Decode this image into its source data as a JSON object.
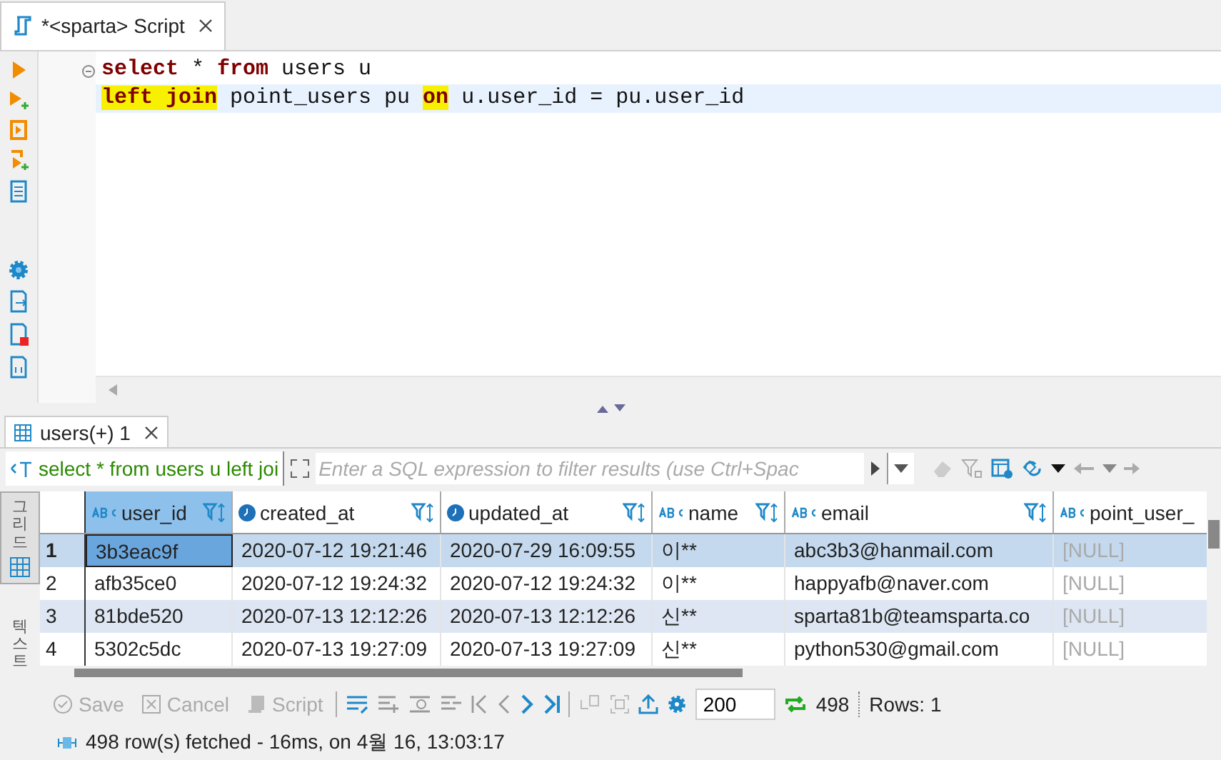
{
  "editor_tab": {
    "title": "*<sparta> Script"
  },
  "code_lines": [
    {
      "current": false,
      "tokens": [
        {
          "text": "select",
          "kind": "keyword",
          "highlighted": false
        },
        {
          "text": " * ",
          "kind": "plain",
          "highlighted": false
        },
        {
          "text": "from",
          "kind": "keyword",
          "highlighted": false
        },
        {
          "text": " users u",
          "kind": "plain",
          "highlighted": false
        }
      ]
    },
    {
      "current": true,
      "tokens": [
        {
          "text": "left join",
          "kind": "keyword",
          "highlighted": true
        },
        {
          "text": " point_users pu ",
          "kind": "plain",
          "highlighted": false
        },
        {
          "text": "on",
          "kind": "keyword",
          "highlighted": true
        },
        {
          "text": " u.user_id = pu.user_id",
          "kind": "plain",
          "highlighted": false
        }
      ]
    }
  ],
  "results_tab": {
    "title": "users(+) 1"
  },
  "filter": {
    "query": "select * from users u left joi",
    "placeholder": "Enter a SQL expression to filter results (use Ctrl+Spac"
  },
  "side_tabs": [
    {
      "label": "그리드",
      "selected": true
    },
    {
      "label": "텍스트",
      "selected": false
    }
  ],
  "columns": [
    {
      "name": "user_id",
      "kind": "text",
      "selected": true
    },
    {
      "name": "created_at",
      "kind": "datetime",
      "selected": false
    },
    {
      "name": "updated_at",
      "kind": "datetime",
      "selected": false
    },
    {
      "name": "name",
      "kind": "text",
      "selected": false
    },
    {
      "name": "email",
      "kind": "text",
      "selected": false
    },
    {
      "name": "point_user_",
      "kind": "text",
      "selected": false
    }
  ],
  "rows": [
    {
      "number": "1",
      "selected": true,
      "cells": [
        {
          "text": "3b3eac9f",
          "is_null": false
        },
        {
          "text": "2020-07-12 19:21:46",
          "is_null": false
        },
        {
          "text": "2020-07-29 16:09:55",
          "is_null": false
        },
        {
          "text": "이**",
          "is_null": false
        },
        {
          "text": "abc3b3@hanmail.com",
          "is_null": false
        },
        {
          "text": "[NULL]",
          "is_null": true
        }
      ]
    },
    {
      "number": "2",
      "selected": false,
      "cells": [
        {
          "text": "afb35ce0",
          "is_null": false
        },
        {
          "text": "2020-07-12 19:24:32",
          "is_null": false
        },
        {
          "text": "2020-07-12 19:24:32",
          "is_null": false
        },
        {
          "text": "이**",
          "is_null": false
        },
        {
          "text": "happyafb@naver.com",
          "is_null": false
        },
        {
          "text": "[NULL]",
          "is_null": true
        }
      ]
    },
    {
      "number": "3",
      "selected": false,
      "cells": [
        {
          "text": "81bde520",
          "is_null": false
        },
        {
          "text": "2020-07-13 12:12:26",
          "is_null": false
        },
        {
          "text": "2020-07-13 12:12:26",
          "is_null": false
        },
        {
          "text": "신**",
          "is_null": false
        },
        {
          "text": "sparta81b@teamsparta.co",
          "is_null": false
        },
        {
          "text": "[NULL]",
          "is_null": true
        }
      ]
    },
    {
      "number": "4",
      "selected": false,
      "cells": [
        {
          "text": "5302c5dc",
          "is_null": false
        },
        {
          "text": "2020-07-13 19:27:09",
          "is_null": false
        },
        {
          "text": "2020-07-13 19:27:09",
          "is_null": false
        },
        {
          "text": "신**",
          "is_null": false
        },
        {
          "text": "python530@gmail.com",
          "is_null": false
        },
        {
          "text": "[NULL]",
          "is_null": true
        }
      ]
    }
  ],
  "toolbar": {
    "buttons": [
      {
        "label": "Save",
        "kind": "save",
        "disabled": true
      },
      {
        "label": "Cancel",
        "kind": "cancel",
        "disabled": true
      },
      {
        "label": "Script",
        "kind": "script",
        "disabled": true
      }
    ],
    "fetch_size": "200",
    "total": "498",
    "rows": "Rows: 1"
  },
  "status": "498 row(s) fetched - 16ms, on 4월 16, 13:03:17"
}
